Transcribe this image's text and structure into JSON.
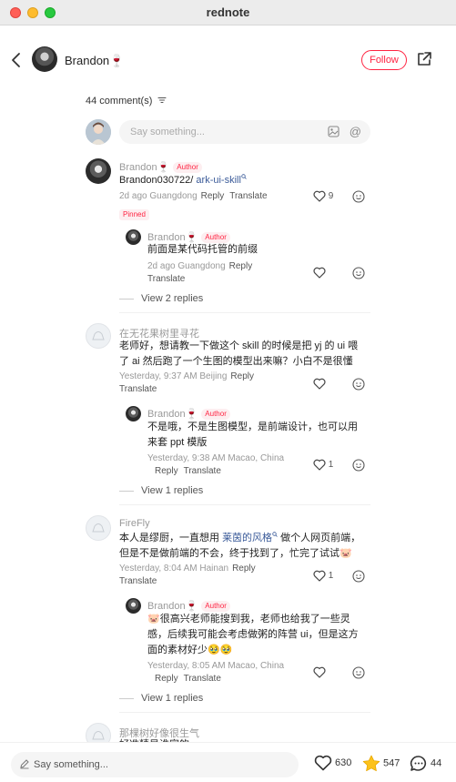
{
  "window": {
    "title": "rednote"
  },
  "header": {
    "author_name": "Brandon🍷",
    "follow_label": "Follow"
  },
  "comments_header": {
    "count_label": "44 comment(s)",
    "input_placeholder": "Say something..."
  },
  "comments": [
    {
      "name": "Brandon🍷",
      "tag": "Author",
      "text_prefix": "Brandon030722/",
      "link": "ark-ui-skill",
      "time": "2d ago Guangdong",
      "reply": "Reply",
      "translate": "Translate",
      "likes": "9",
      "pinned": "Pinned",
      "sub": {
        "name": "Brandon🍷",
        "tag": "Author",
        "text": "前面是某代码托管的前缀",
        "time": "2d ago Guangdong",
        "reply": "Reply",
        "translate": "Translate"
      },
      "view_replies": "View 2 replies"
    },
    {
      "name": "在无花果树里寻花",
      "text": "老师好，想请教一下做这个 skill 的时候是把 yj 的 ui 喂了 ai 然后跑了一个生图的模型出来嘛？小白不是很懂",
      "time": "Yesterday, 9:37 AM Beijing",
      "reply": "Reply",
      "translate": "Translate",
      "sub": {
        "name": "Brandon🍷",
        "tag": "Author",
        "text": "不是哦，不是生图模型，是前端设计，也可以用来套 ppt 模版",
        "time": "Yesterday, 9:38 AM Macao, China",
        "reply": "Reply",
        "translate": "Translate",
        "likes": "1"
      },
      "view_replies": "View 1 replies"
    },
    {
      "name": "FireFly",
      "text_prefix": "本人是缪厨，一直想用",
      "link": "莱茵的风格",
      "text_suffix": "做个人网页前端，但是不是做前端的不会，终于找到了，忙完了试试🐷",
      "time": "Yesterday, 8:04 AM Hainan",
      "reply": "Reply",
      "translate": "Translate",
      "likes": "1",
      "sub": {
        "name": "Brandon🍷",
        "tag": "Author",
        "text": "🐷很高兴老师能搜到我，老师也给我了一些灵感，后续我可能会考虑做粥的阵营 ui，但是这方面的素材好少🥹🥹",
        "time": "Yesterday, 8:05 AM Macao, China",
        "reply": "Reply",
        "translate": "Translate"
      },
      "view_replies": "View 1 replies"
    },
    {
      "name": "那棵树好像很生气",
      "text": "好准精是谁家的"
    }
  ],
  "bottom": {
    "placeholder": "Say something...",
    "likes": "630",
    "stars": "547",
    "comments": "44"
  },
  "colors": {
    "accent": "#ff2442",
    "link": "#3b5b99"
  }
}
